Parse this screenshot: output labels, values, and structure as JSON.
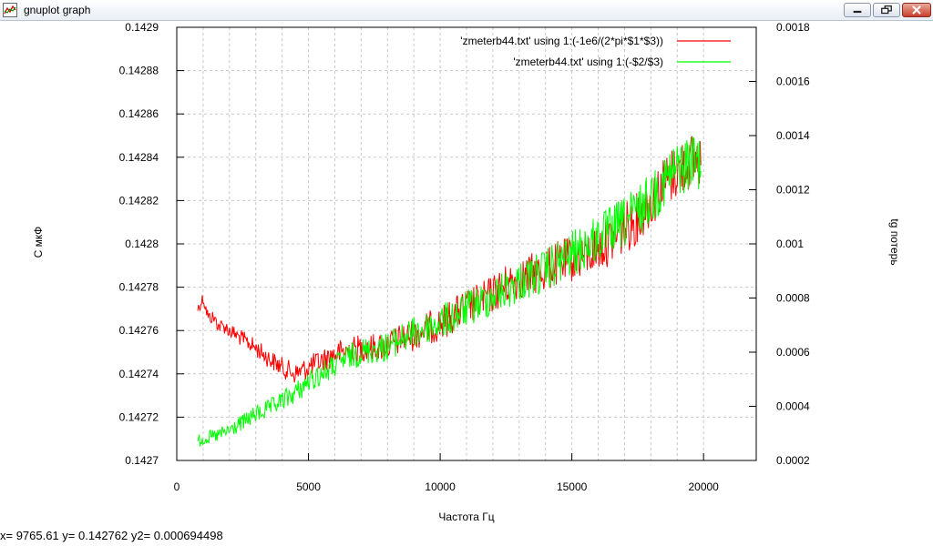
{
  "window": {
    "title": "gnuplot graph"
  },
  "status": {
    "text": "x= 9765.61 y= 0.142762 y2= 0.000694498"
  },
  "chart_data": {
    "type": "line",
    "xlabel": "Частота Гц",
    "ylabel": "C мкФ",
    "y2label": "tg потерь",
    "xlim": [
      0,
      22000
    ],
    "ylim": [
      0.1427,
      0.1429
    ],
    "y2lim": [
      0.0002,
      0.0018
    ],
    "x_ticks": [
      "0",
      "5000",
      "10000",
      "15000",
      "20000"
    ],
    "y_ticks": [
      "0.1427",
      "0.14272",
      "0.14274",
      "0.14276",
      "0.14278",
      "0.1428",
      "0.14282",
      "0.14284",
      "0.14286",
      "0.14288",
      "0.1429"
    ],
    "y2_ticks": [
      "0.0002",
      "0.0004",
      "0.0006",
      "0.0008",
      "0.001",
      "0.0012",
      "0.0014",
      "0.0016",
      "0.0018"
    ],
    "grid": true,
    "legend_position": "top-right",
    "series": [
      {
        "name": "'zmeterb44.txt' using 1:(-1e6/(2*pi*$1*$3))",
        "axis": "y",
        "color": "#ff0000",
        "points": [
          [
            800,
            0.14277
          ],
          [
            1000,
            0.142775
          ],
          [
            1200,
            0.142766
          ],
          [
            1400,
            0.142766
          ],
          [
            1600,
            0.142762
          ],
          [
            1800,
            0.142762
          ],
          [
            2000,
            0.14276
          ],
          [
            2500,
            0.142756
          ],
          [
            3000,
            0.142752
          ],
          [
            3500,
            0.142747
          ],
          [
            4000,
            0.142743
          ],
          [
            4500,
            0.14274
          ],
          [
            5000,
            0.142743
          ],
          [
            5500,
            0.142746
          ],
          [
            6000,
            0.142749
          ],
          [
            6500,
            0.142751
          ],
          [
            7000,
            0.142752
          ],
          [
            7500,
            0.142752
          ],
          [
            8000,
            0.142753
          ],
          [
            8500,
            0.142756
          ],
          [
            9000,
            0.142758
          ],
          [
            9500,
            0.142761
          ],
          [
            10000,
            0.142763
          ],
          [
            10500,
            0.142767
          ],
          [
            11000,
            0.142771
          ],
          [
            11500,
            0.142773
          ],
          [
            12000,
            0.142777
          ],
          [
            12500,
            0.142781
          ],
          [
            13000,
            0.142784
          ],
          [
            13500,
            0.142786
          ],
          [
            14000,
            0.142788
          ],
          [
            14500,
            0.142791
          ],
          [
            15000,
            0.142793
          ],
          [
            15500,
            0.142795
          ],
          [
            16000,
            0.142798
          ],
          [
            16500,
            0.142802
          ],
          [
            17000,
            0.142807
          ],
          [
            17500,
            0.142812
          ],
          [
            18000,
            0.14282
          ],
          [
            18500,
            0.142828
          ],
          [
            19000,
            0.142834
          ],
          [
            19500,
            0.142838
          ],
          [
            19900,
            0.14284
          ]
        ]
      },
      {
        "name": "'zmeterb44.txt' using 1:(-$2/$3)",
        "axis": "y2",
        "color": "#00ff00",
        "points": [
          [
            800,
            0.00027
          ],
          [
            1000,
            0.00028
          ],
          [
            1500,
            0.00029
          ],
          [
            2000,
            0.00031
          ],
          [
            2500,
            0.00034
          ],
          [
            3000,
            0.00037
          ],
          [
            3500,
            0.00039
          ],
          [
            4000,
            0.00042
          ],
          [
            4500,
            0.00045
          ],
          [
            5000,
            0.00049
          ],
          [
            5500,
            0.00052
          ],
          [
            6000,
            0.00055
          ],
          [
            6500,
            0.00058
          ],
          [
            7000,
            0.0006
          ],
          [
            7500,
            0.00061
          ],
          [
            8000,
            0.00062
          ],
          [
            8500,
            0.00065
          ],
          [
            9000,
            0.00067
          ],
          [
            9500,
            0.00069
          ],
          [
            10000,
            0.00071
          ],
          [
            10500,
            0.00073
          ],
          [
            11000,
            0.00076
          ],
          [
            11500,
            0.00078
          ],
          [
            12000,
            0.00081
          ],
          [
            12500,
            0.00083
          ],
          [
            13000,
            0.00086
          ],
          [
            13500,
            0.00088
          ],
          [
            14000,
            0.0009
          ],
          [
            14500,
            0.00093
          ],
          [
            15000,
            0.00096
          ],
          [
            15500,
            0.00099
          ],
          [
            16000,
            0.00102
          ],
          [
            16500,
            0.00105
          ],
          [
            17000,
            0.00108
          ],
          [
            17500,
            0.00112
          ],
          [
            18000,
            0.00117
          ],
          [
            18500,
            0.00123
          ],
          [
            19000,
            0.00128
          ],
          [
            19500,
            0.0013
          ],
          [
            19900,
            0.00131
          ]
        ]
      }
    ]
  }
}
